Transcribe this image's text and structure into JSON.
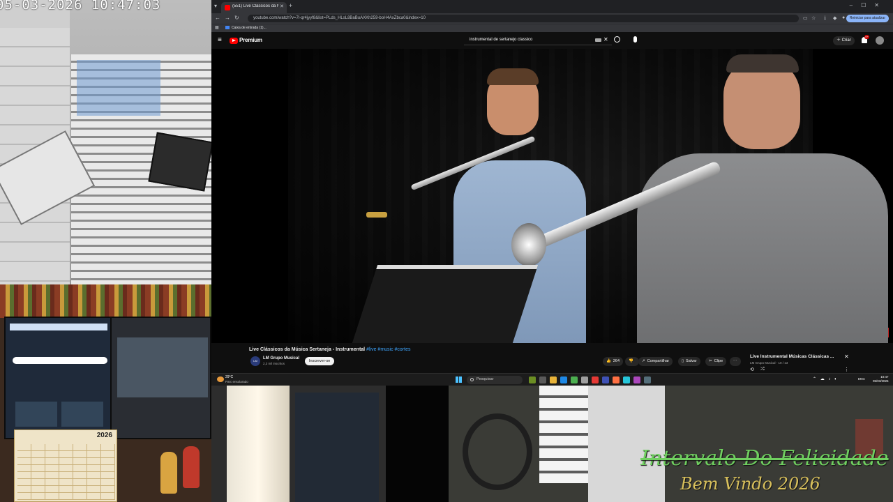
{
  "camera": {
    "timestamp": "05-03-2026  10:47:03",
    "calendar_year": "2026",
    "overlay_title": "Intervalo Do Felicidade",
    "overlay_subtitle": "Bem Vindo 2026"
  },
  "browser": {
    "tab_title": "(551) Live Clássicos da Mú",
    "url": "youtube.com/watch?v=7l-qr4jyyf8&list=PLds_HLsL8BaBuAXKh259-boH4AxZbca0&index=10",
    "bookmark": "Caixa de entrada (1)...",
    "sync_label": "Reiniciar para atualizar"
  },
  "youtube": {
    "logo_text": "Premium",
    "search_query": "instrumental de sertanejo classico",
    "create_label": "Criar",
    "notification_count": "9+",
    "accent_color": "#ff0000"
  },
  "video": {
    "title": "Live Clássicos da Música Sertaneja - Instrumental",
    "tags": "#live #music #cortes",
    "channel_name": "LM Grupo Musical",
    "channel_subs": "2,3 mil inscritos",
    "channel_avatar_text": "LM",
    "subscribe_label": "Inscrever-se",
    "likes": "264",
    "share_label": "Compartilhar",
    "save_label": "Salvar",
    "clip_label": "Clipe",
    "more_label": "⋯"
  },
  "playlist": {
    "title": "Live Instrumental Músicas Clássicas ...",
    "subtitle": "LM Grupo Musical - 10 / 13"
  },
  "taskbar": {
    "temp": "29°C",
    "weather": "Parc ensolarado",
    "search_placeholder": "Pesquisar",
    "lang": "ENG",
    "time": "10:47",
    "date": "05/03/2026"
  }
}
